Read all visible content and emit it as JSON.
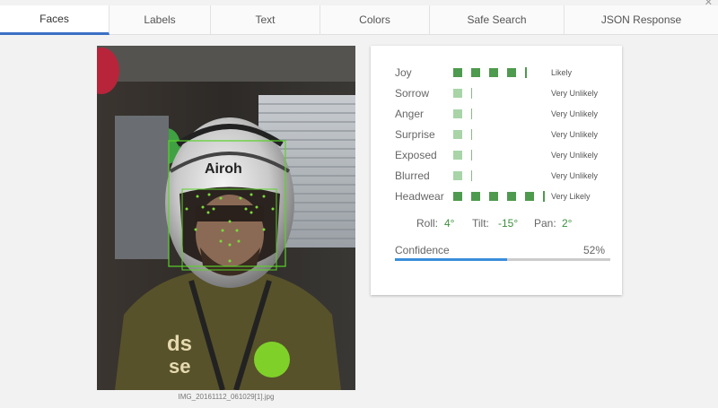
{
  "tabs": [
    {
      "label": "Faces",
      "active": true
    },
    {
      "label": "Labels",
      "active": false
    },
    {
      "label": "Text",
      "active": false
    },
    {
      "label": "Colors",
      "active": false
    },
    {
      "label": "Safe Search",
      "active": false
    },
    {
      "label": "JSON Response",
      "active": false
    }
  ],
  "image": {
    "caption": "IMG_20161112_061029[1].jpg",
    "helmet_text": "Airoh"
  },
  "face_attributes": [
    {
      "name": "Joy",
      "likelihood": "Likely",
      "level": 4
    },
    {
      "name": "Sorrow",
      "likelihood": "Very Unlikely",
      "level": 1
    },
    {
      "name": "Anger",
      "likelihood": "Very Unlikely",
      "level": 1
    },
    {
      "name": "Surprise",
      "likelihood": "Very Unlikely",
      "level": 1
    },
    {
      "name": "Exposed",
      "likelihood": "Very Unlikely",
      "level": 1
    },
    {
      "name": "Blurred",
      "likelihood": "Very Unlikely",
      "level": 1
    },
    {
      "name": "Headwear",
      "likelihood": "Very Likely",
      "level": 5
    }
  ],
  "angles": {
    "roll_label": "Roll:",
    "roll": "4°",
    "tilt_label": "Tilt:",
    "tilt": "-15°",
    "pan_label": "Pan:",
    "pan": "2°"
  },
  "confidence": {
    "label": "Confidence",
    "value": "52%",
    "fraction": 0.52
  },
  "colors": {
    "accent": "#3b6fc4",
    "bar": "#4e9a4e",
    "bar_faint": "#a8d4a8",
    "confidence": "#3a8edb",
    "angle_value": "#3e8e3e"
  }
}
